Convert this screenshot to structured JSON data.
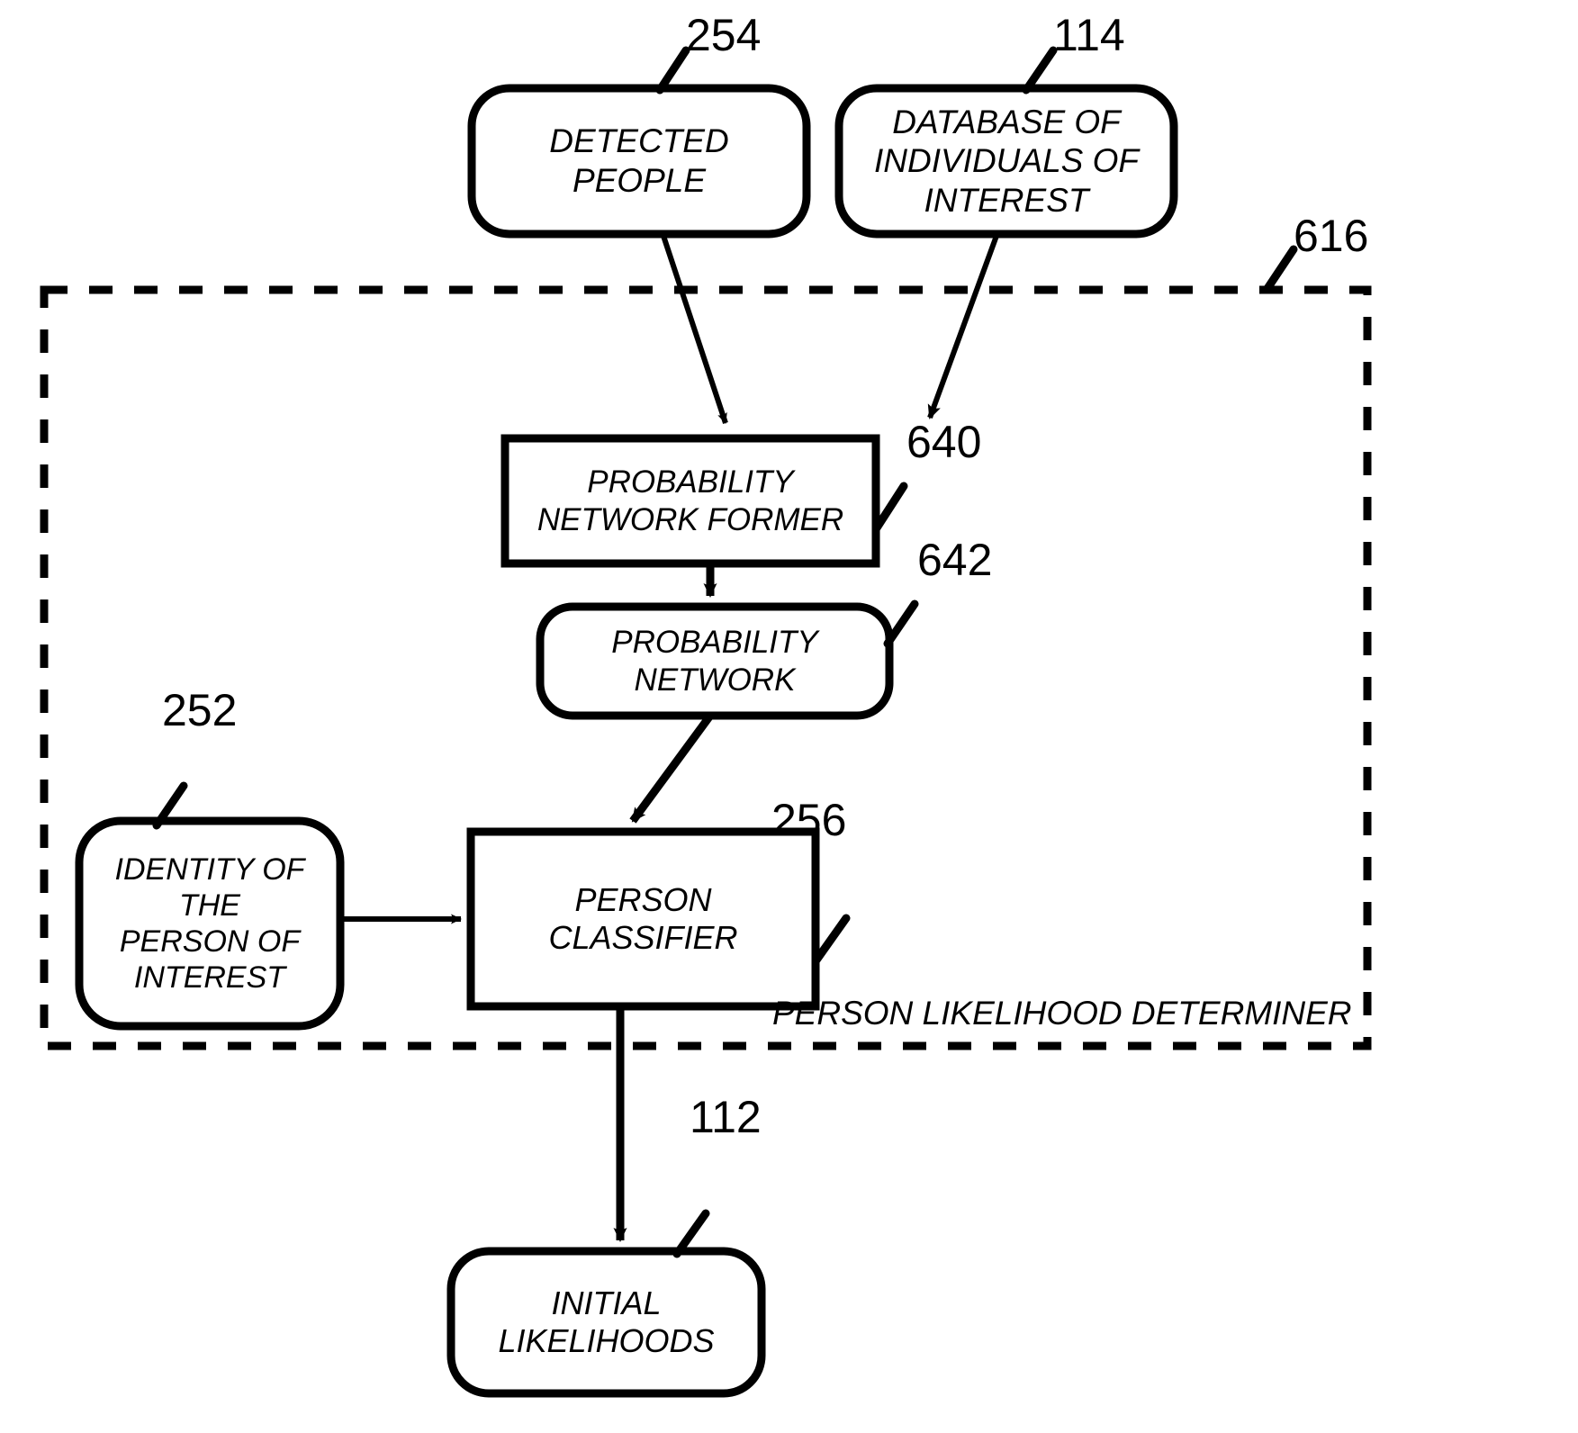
{
  "figure": {
    "type": "patent-block-diagram",
    "background_color": "#ffffff",
    "line_color": "#000000"
  },
  "nodes": {
    "detected_people": {
      "label": "DETECTED\nPEOPLE",
      "ref": "254",
      "shape": "rounded-rect"
    },
    "database_of_individuals": {
      "label": "DATABASE OF\nINDIVIDUALS OF\nINTEREST",
      "ref": "114",
      "shape": "rounded-rect"
    },
    "probability_network_former": {
      "label": "PROBABILITY\nNETWORK FORMER",
      "ref": "640",
      "shape": "rect"
    },
    "probability_network": {
      "label": "PROBABILITY\nNETWORK",
      "ref": "642",
      "shape": "rounded-rect"
    },
    "identity_of_person_of_interest": {
      "label": "IDENTITY OF\nTHE\nPERSON OF\nINTEREST",
      "ref": "252",
      "shape": "rounded-rect"
    },
    "person_classifier": {
      "label": "PERSON\nCLASSIFIER",
      "ref": "256",
      "shape": "rect"
    },
    "initial_likelihoods": {
      "label": "INITIAL\nLIKELIHOODS",
      "ref": "112",
      "shape": "rounded-rect"
    }
  },
  "container": {
    "caption": "PERSON LIKELIHOOD DETERMINER",
    "ref": "616",
    "style": "dashed-rect"
  },
  "edges": [
    {
      "name": "detected-people-to-former",
      "from": "detected_people",
      "to": "probability_network_former"
    },
    {
      "name": "database-to-former",
      "from": "database_of_individuals",
      "to": "probability_network_former"
    },
    {
      "name": "former-to-network",
      "from": "probability_network_former",
      "to": "probability_network"
    },
    {
      "name": "network-to-classifier",
      "from": "probability_network",
      "to": "person_classifier"
    },
    {
      "name": "identity-to-classifier",
      "from": "identity_of_person_of_interest",
      "to": "person_classifier"
    },
    {
      "name": "classifier-to-initial-likelihoods",
      "from": "person_classifier",
      "to": "initial_likelihoods"
    }
  ]
}
